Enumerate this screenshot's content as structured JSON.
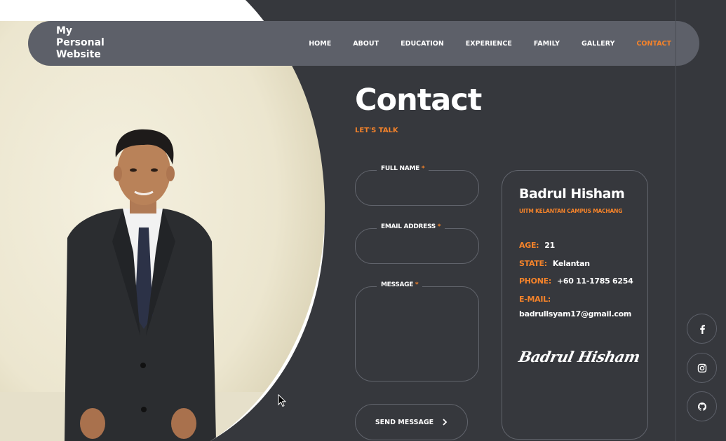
{
  "site": {
    "logo_text": "My Personal Website"
  },
  "nav": {
    "items": [
      {
        "label": "HOME"
      },
      {
        "label": "ABOUT"
      },
      {
        "label": "EDUCATION"
      },
      {
        "label": "EXPERIENCE"
      },
      {
        "label": "FAMILY"
      },
      {
        "label": "GALLERY"
      },
      {
        "label": "CONTACT"
      }
    ],
    "active": "CONTACT"
  },
  "page": {
    "title": "Contact",
    "subtitle": "LET'S TALK"
  },
  "form": {
    "full_name": {
      "label": "FULL NAME",
      "required": "*",
      "value": ""
    },
    "email": {
      "label": "EMAIL ADDRESS",
      "required": "*",
      "value": ""
    },
    "message": {
      "label": "MESSAGE",
      "required": "*",
      "value": ""
    },
    "send_label": "SEND MESSAGE"
  },
  "card": {
    "name": "Badrul Hisham",
    "org": "UITM KELANTAN CAMPUS MACHANG",
    "age_label": "AGE:",
    "age": "21",
    "state_label": "STATE:",
    "state": "Kelantan",
    "phone_label": "PHONE:",
    "phone": "+60 11-1785 6254",
    "email_label": "E-MAIL:",
    "email": "badrullsyam17@gmail.com",
    "signature": "Badrul Hisham"
  },
  "social": [
    {
      "icon": "facebook-icon"
    },
    {
      "icon": "instagram-icon"
    },
    {
      "icon": "github-icon"
    }
  ],
  "colors": {
    "accent": "#f5832a",
    "dark": "#36383d",
    "header": "#5d6069"
  }
}
